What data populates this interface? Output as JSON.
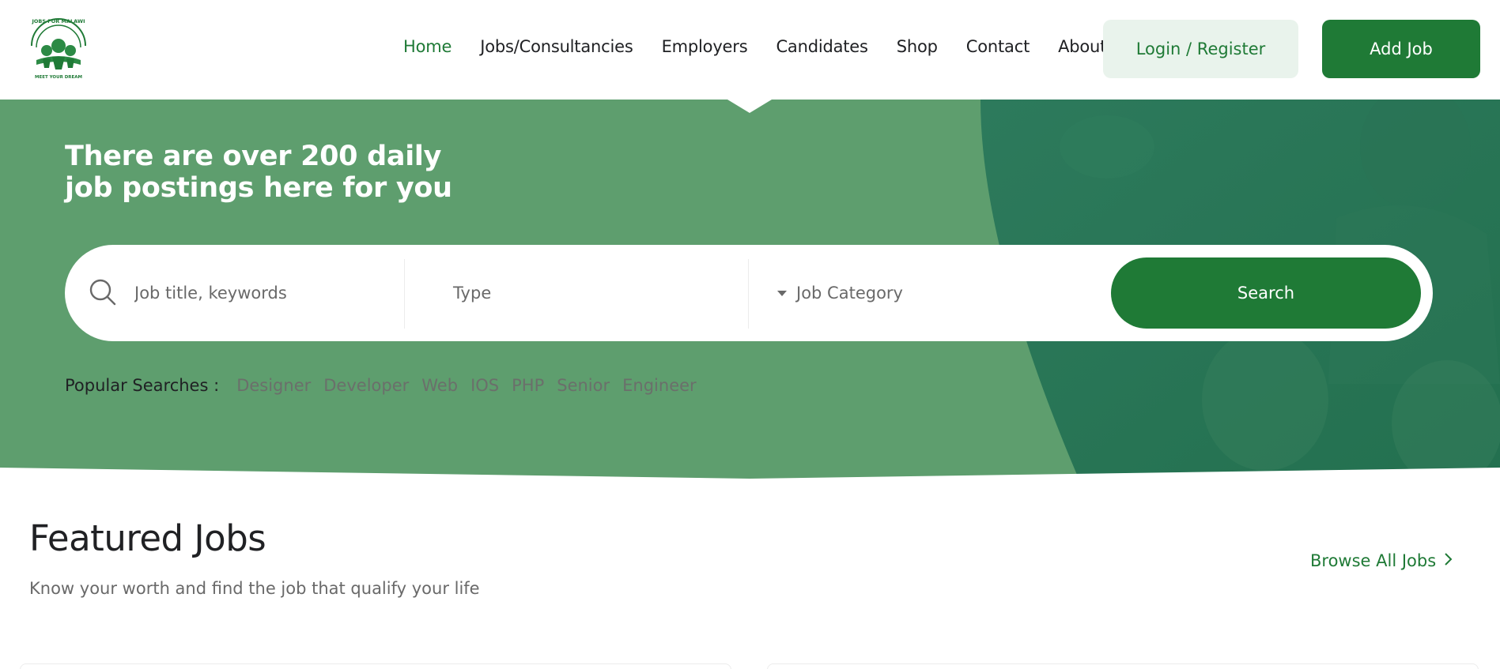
{
  "header": {
    "logo_alt": "Jobs For Malawi",
    "logo_text_top": "JOBS FOR MALAWI",
    "logo_text_bottom": "MEET YOUR DREAM",
    "nav": [
      "Home",
      "Jobs/Consultancies",
      "Employers",
      "Candidates",
      "Shop",
      "Contact",
      "About"
    ],
    "active_nav": "Home",
    "login_label": "Login / Register",
    "add_job_label": "Add Job"
  },
  "hero": {
    "title_pre": "There are over ",
    "title_bold": "200",
    "title_post": " daily",
    "title_line2": "job postings here for you",
    "search": {
      "keyword_placeholder": "Job title, keywords",
      "type_label": "Type",
      "category_label": "Job Category",
      "search_button": "Search"
    },
    "popular": {
      "label": "Popular Searches :",
      "items": [
        "Designer",
        "Developer",
        "Web",
        "IOS",
        "PHP",
        "Senior",
        "Engineer"
      ]
    }
  },
  "featured": {
    "title": "Featured Jobs",
    "subtitle": "Know your worth and find the job that qualify your life",
    "browse_label": "Browse All Jobs"
  },
  "colors": {
    "brand_green": "#1f7a36",
    "hero_green": "#5e9e6e",
    "hero_dark": "#2e7a5a"
  },
  "icons": [
    "search-icon",
    "chevron-right-icon",
    "caret-down-icon"
  ]
}
